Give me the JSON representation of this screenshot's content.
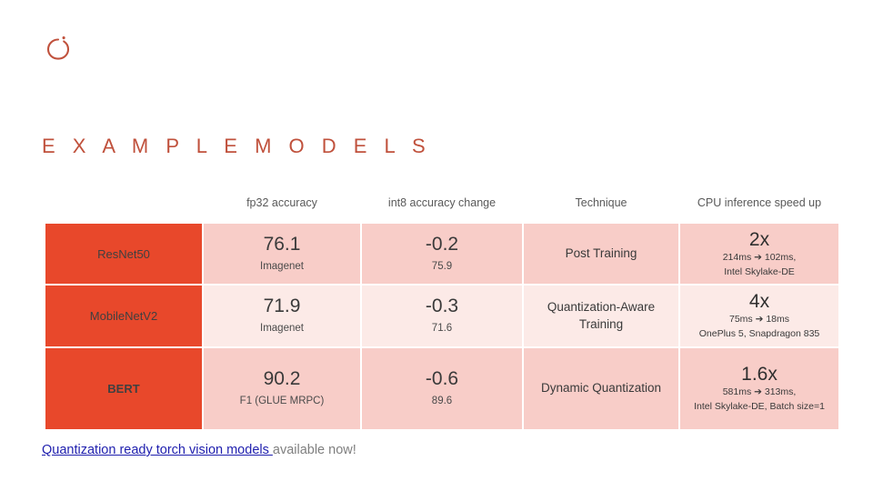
{
  "brand": {
    "logo_icon": "pytorch-flame-icon",
    "logo_color": "#C0513C"
  },
  "slide": {
    "title": "E X A M P L E   M O D E L S",
    "title_color": "#C0513C"
  },
  "colors": {
    "accent_orange": "#E8482B",
    "cell_pink_dark": "#F8CDC8",
    "cell_pink_light": "#FCEAE7",
    "link_blue": "#1F1FAE",
    "body_gray": "#7f7f7f"
  },
  "table": {
    "headers": [
      "",
      "fp32 accuracy",
      "int8 accuracy change",
      "Technique",
      "CPU inference speed up"
    ],
    "rows": [
      {
        "model": "ResNet50",
        "fp32_value": "76.1",
        "fp32_dataset": "Imagenet",
        "int8_change": "-0.2",
        "int8_value": "75.9",
        "technique": "Post Training",
        "speedup": "2x",
        "latency_before": "214ms",
        "latency_arrow": "➔",
        "latency_after": "102ms,",
        "hardware": "Intel Skylake-DE"
      },
      {
        "model": "MobileNetV2",
        "fp32_value": "71.9",
        "fp32_dataset": "Imagenet",
        "int8_change": "-0.3",
        "int8_value": "71.6",
        "technique": "Quantization-Aware Training",
        "speedup": "4x",
        "latency_before": "75ms",
        "latency_arrow": "➔",
        "latency_after": "18ms",
        "hardware": "OnePlus 5, Snapdragon 835"
      },
      {
        "model": "BERT",
        "fp32_value": "90.2",
        "fp32_dataset": "F1 (GLUE MRPC)",
        "int8_change": "-0.6",
        "int8_value": "89.6",
        "technique": "Dynamic Quantization",
        "speedup": "1.6x",
        "latency_before": "581ms",
        "latency_arrow": "➔",
        "latency_after": "313ms,",
        "hardware": "Intel Skylake-DE, Batch size=1"
      }
    ]
  },
  "footer": {
    "link_text": "Quantization ready torch vision models ",
    "rest_text": "available now!"
  }
}
